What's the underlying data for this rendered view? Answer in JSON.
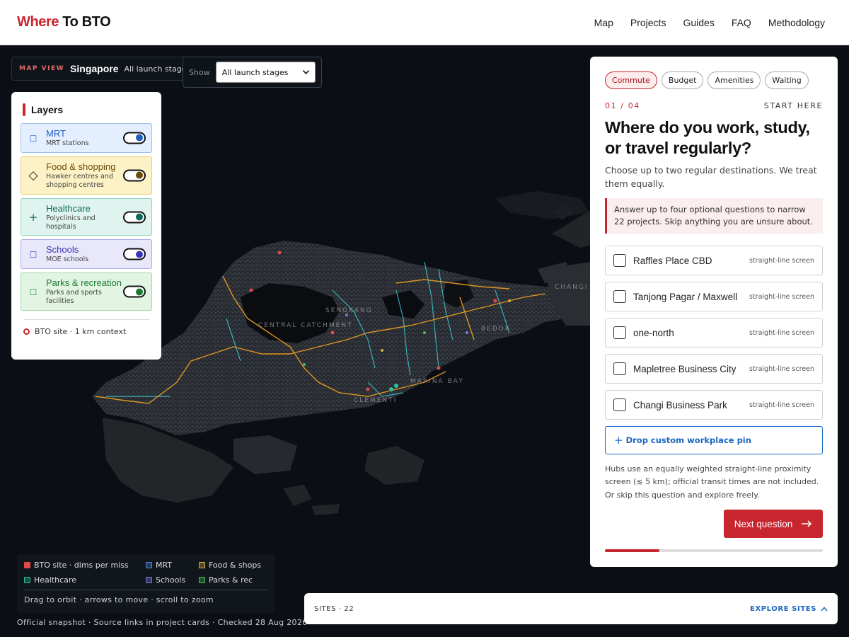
{
  "header": {
    "logo_where": "Where",
    "logo_rest": "To BTO",
    "nav": [
      "Map",
      "Projects",
      "Guides",
      "FAQ",
      "Methodology"
    ]
  },
  "mapview": {
    "kicker": "MAP VIEW",
    "city": "Singapore",
    "stage": "All launch stages",
    "show_label": "Show",
    "show_selected": "All launch stages"
  },
  "layers": {
    "title": "Layers",
    "items": [
      {
        "name": "MRT",
        "desc": "MRT stations",
        "icon": "square-icon",
        "color": "#1f5fbf",
        "bg": "#e3efff",
        "border": "#9fbfe6",
        "on": true
      },
      {
        "name": "Food & shopping",
        "desc": "Hawker centres and shopping centres",
        "icon": "diamond-icon",
        "color": "#6b4a06",
        "bg": "#fdf2c6",
        "border": "#e5cf7a",
        "on": true
      },
      {
        "name": "Healthcare",
        "desc": "Polyclinics and hospitals",
        "icon": "plus-icon",
        "color": "#0f6a5b",
        "bg": "#dff4ee",
        "border": "#8fd2bf",
        "on": true
      },
      {
        "name": "Schools",
        "desc": "MOE schools",
        "icon": "square-icon",
        "color": "#3936b8",
        "bg": "#e9e8fb",
        "border": "#aaa8e6",
        "on": true
      },
      {
        "name": "Parks & recreation",
        "desc": "Parks and sports facilities",
        "icon": "square-icon",
        "color": "#1b7a32",
        "bg": "#e2f5e3",
        "border": "#9fd6a5",
        "on": true
      }
    ],
    "bto_legend": "BTO site · 1 km context"
  },
  "map_labels": [
    "CENTRAL CATCHMENT",
    "CHANGI",
    "SENGKANG",
    "BEDOK",
    "MARINA BAY",
    "CLEMENTI"
  ],
  "legend": {
    "items": [
      {
        "label": "BTO site · dims per miss",
        "color": "#e24a4a"
      },
      {
        "label": "MRT",
        "color": "#4a8be0"
      },
      {
        "label": "Food & shops",
        "color": "#d4b43a"
      },
      {
        "label": "Healthcare",
        "color": "#2fbf9a"
      },
      {
        "label": "Schools",
        "color": "#7a79e0"
      },
      {
        "label": "Parks & rec",
        "color": "#43c05a"
      }
    ],
    "hint": "Drag to orbit · arrows to move · scroll to zoom"
  },
  "snapshot": "Official snapshot · Source links in project cards · Checked 28 Aug 2026",
  "sites_bar": {
    "count": "SITES · 22",
    "explore": "EXPLORE SITES"
  },
  "quiz": {
    "chips": [
      "Commute",
      "Budget",
      "Amenities",
      "Waiting"
    ],
    "active_chip": "Commute",
    "step": "01 / 04",
    "start": "START HERE",
    "title": "Where do you work, study, or travel regularly?",
    "subtitle": "Choose up to two regular destinations. We treat them equally.",
    "note": "Answer up to four optional questions to narrow 22 projects. Skip anything you are unsure about.",
    "options": [
      {
        "label": "Raffles Place CBD",
        "tag": "straight-line screen",
        "checked": false
      },
      {
        "label": "Tanjong Pagar / Maxwell",
        "tag": "straight-line screen",
        "checked": false
      },
      {
        "label": "one-north",
        "tag": "straight-line screen",
        "checked": false
      },
      {
        "label": "Mapletree Business City",
        "tag": "straight-line screen",
        "checked": false
      },
      {
        "label": "Changi Business Park",
        "tag": "straight-line screen",
        "checked": false
      }
    ],
    "drop_pin": "Drop custom workplace pin",
    "hubs_note": "Hubs use an equally weighted straight-line proximity screen (≲ 5 km); official transit times are not included. Or skip this question and explore freely.",
    "next": "Next question",
    "progress": 0.25
  }
}
